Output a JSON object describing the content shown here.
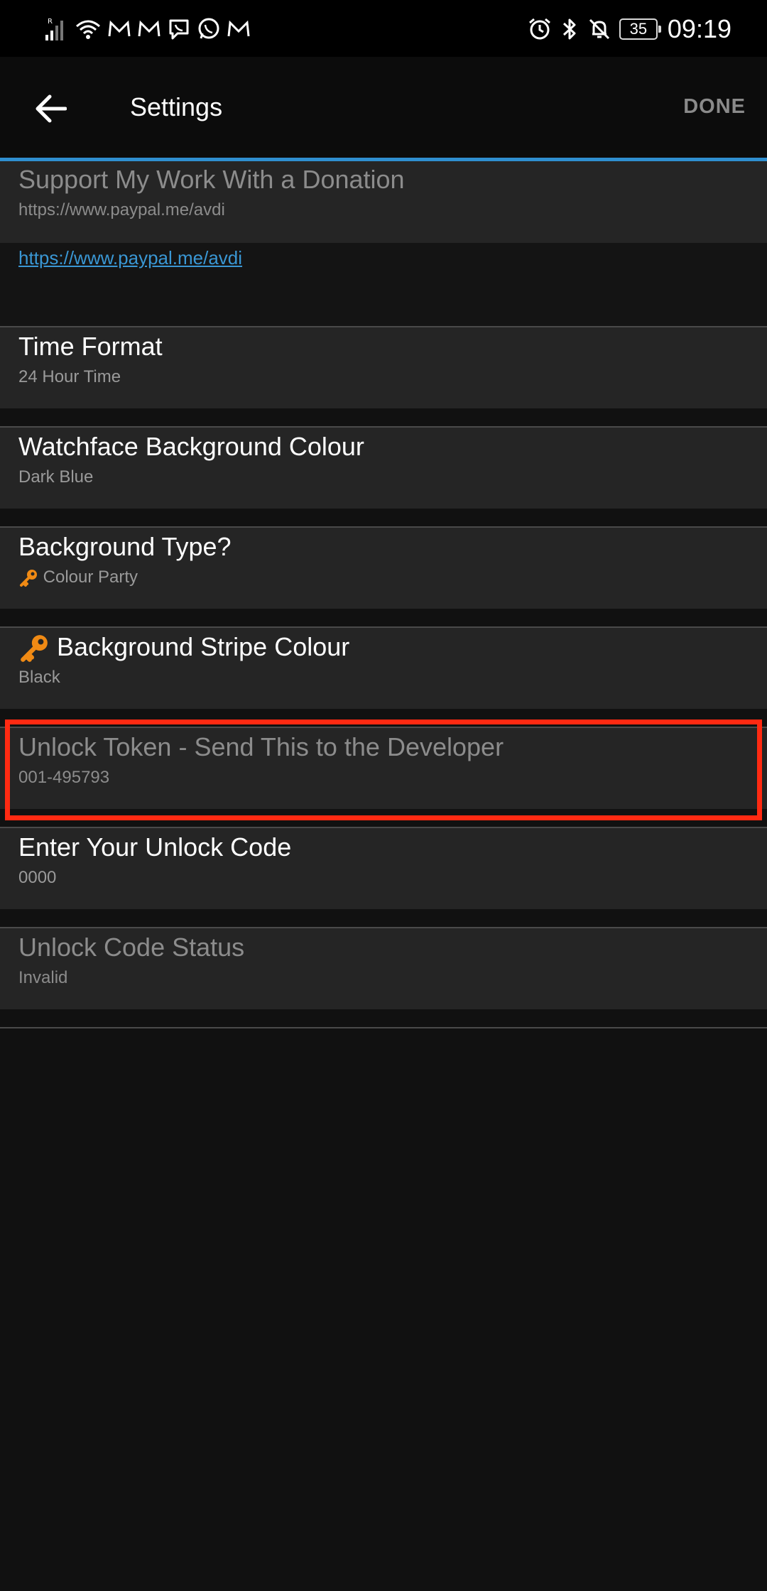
{
  "status_bar": {
    "time": "09:19",
    "battery": "35",
    "left_icons": [
      "signal-icon",
      "wifi-icon",
      "mail-icon",
      "mail-icon",
      "viber-icon",
      "whatsapp-icon",
      "mail-icon"
    ],
    "right_icons": [
      "alarm-icon",
      "bluetooth-icon",
      "bell-off-icon",
      "battery-icon"
    ]
  },
  "app_bar": {
    "title": "Settings",
    "done_label": "DONE"
  },
  "donation": {
    "title": "Support My Work With a Donation",
    "summary": "https://www.paypal.me/avdi",
    "link": "https://www.paypal.me/avdi"
  },
  "prefs": [
    {
      "title": "Time Format",
      "summary": "24 Hour Time"
    },
    {
      "title": "Watchface Background Colour",
      "summary": "Dark Blue"
    },
    {
      "title": "Background Type?",
      "summary": "Colour Party"
    },
    {
      "title": "Background Stripe Colour",
      "summary": "Black"
    },
    {
      "title": "Unlock Token - Send This to the Developer",
      "summary": "001-495793"
    },
    {
      "title": "Enter Your Unlock Code",
      "summary": "0000"
    },
    {
      "title": "Unlock Code Status",
      "summary": "Invalid"
    }
  ],
  "colors": {
    "accent": "#2f8fd0",
    "highlight": "#ff2a12",
    "key_icon": "#f08a14"
  }
}
